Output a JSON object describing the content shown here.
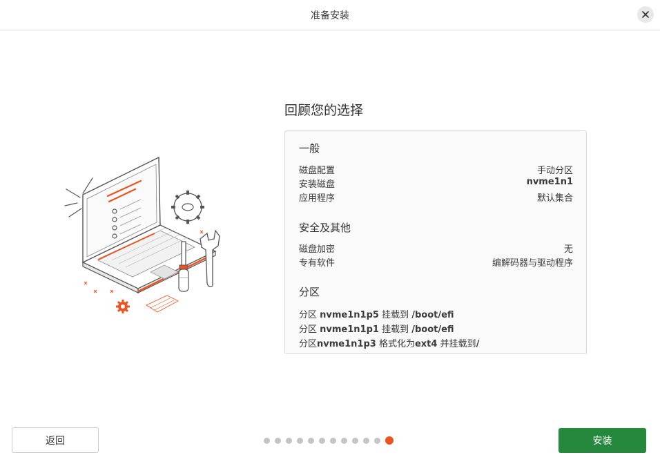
{
  "window": {
    "title": "准备安装"
  },
  "main": {
    "heading": "回顾您的选择",
    "general": {
      "title": "一般",
      "rows": [
        {
          "key": "磁盘配置",
          "value": "手动分区"
        },
        {
          "key": "安装磁盘",
          "value": "nvme1n1"
        },
        {
          "key": "应用程序",
          "value": "默认集合"
        }
      ]
    },
    "security": {
      "title": "安全及其他",
      "rows": [
        {
          "key": "磁盘加密",
          "value": "无"
        },
        {
          "key": "专有软件",
          "value": "编解码器与驱动程序"
        }
      ]
    },
    "partitions": {
      "title": "分区",
      "lines": [
        {
          "prefix": "分区 ",
          "device": "nvme1n1p5",
          "middle": " 挂载到 ",
          "target": "/boot/efi",
          "suffix": ""
        },
        {
          "prefix": "分区 ",
          "device": "nvme1n1p1",
          "middle": " 挂载到 ",
          "target": "/boot/efi",
          "suffix": ""
        },
        {
          "prefix": "分区",
          "device": "nvme1n1p3",
          "middle": " 格式化为",
          "target": "ext4",
          "suffix": " 并挂载到",
          "mount": "/"
        }
      ]
    }
  },
  "footer": {
    "back_label": "返回",
    "install_label": "安装",
    "pager": {
      "total": 12,
      "current": 12
    }
  },
  "colors": {
    "accent": "#e95420",
    "install": "#26883c"
  },
  "icons": {
    "close": "close-icon",
    "illustration": "laptop-tools-illustration"
  }
}
